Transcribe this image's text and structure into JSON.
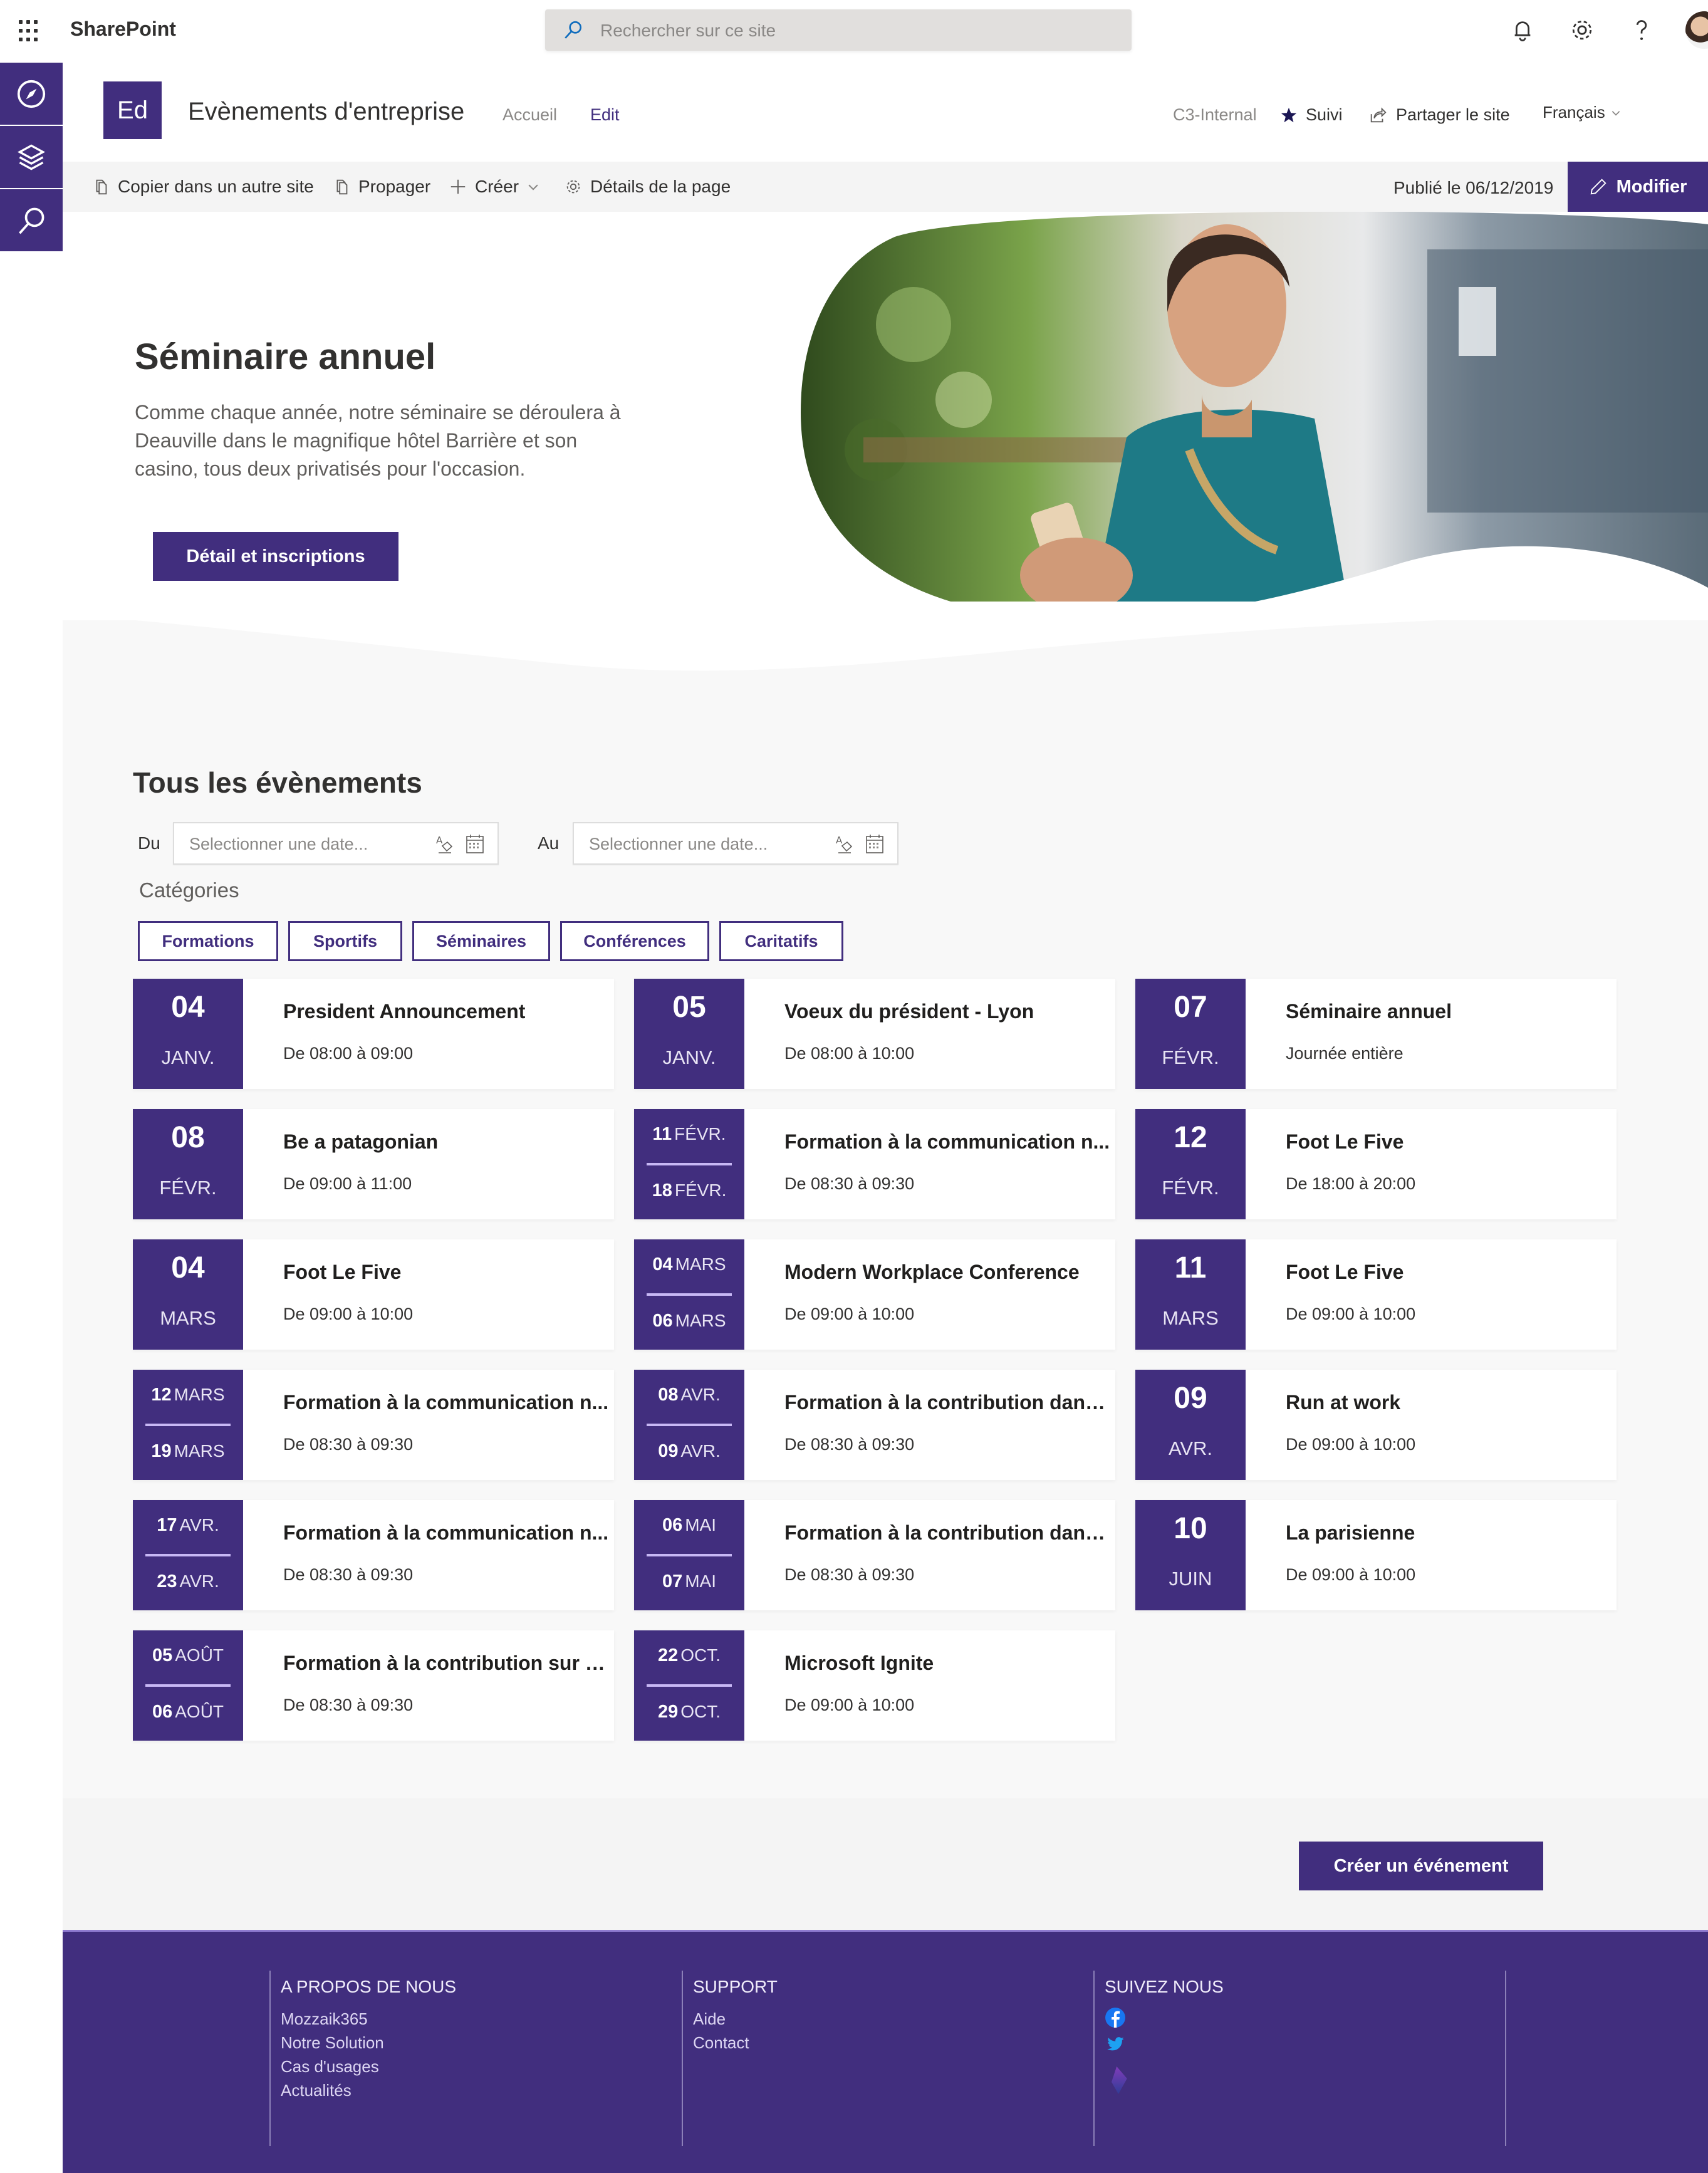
{
  "suitebar": {
    "app_name": "SharePoint",
    "search_placeholder": "Rechercher sur ce site",
    "icons": [
      "waffle-icon",
      "bell-icon",
      "gear-icon",
      "help-icon",
      "avatar"
    ]
  },
  "rail": {
    "items": [
      {
        "icon": "compass-icon",
        "label": "Explorer"
      },
      {
        "icon": "layers-icon",
        "label": "Sites"
      },
      {
        "icon": "search-icon",
        "label": "Rechercher"
      }
    ]
  },
  "site": {
    "logo_initials": "Ed",
    "title": "Evènements d'entreprise",
    "nav": [
      {
        "label": "Accueil"
      },
      {
        "label": "Edit"
      }
    ],
    "classification": "C3-Internal",
    "follow_label": "Suivi",
    "share_label": "Partager le site",
    "language": "Français"
  },
  "commandbar": {
    "items": [
      {
        "label": "Copier dans un autre site",
        "icon": "copy-icon"
      },
      {
        "label": "Propager",
        "icon": "copy-icon"
      },
      {
        "label": "Créer",
        "icon": "plus-icon"
      },
      {
        "label": "Détails de la page",
        "icon": "gear-icon"
      }
    ],
    "published": "Publié le 06/12/2019",
    "modify_label": "Modifier"
  },
  "hero": {
    "title": "Séminaire annuel",
    "description": "Comme chaque année, notre séminaire se déroulera à Deauville dans le magnifique hôtel Barrière et son casino, tous deux privatisés pour l'occasion.",
    "button_label": "Détail et inscriptions"
  },
  "events": {
    "title": "Tous les évènements",
    "from_label": "Du",
    "to_label": "Au",
    "date_placeholder": "Selectionner une date...",
    "categories_label": "Catégories",
    "categories": [
      "Formations",
      "Sportifs",
      "Séminaires",
      "Conférences",
      "Caritatifs"
    ],
    "items": [
      {
        "day": "04",
        "month": "JANV.",
        "title": "President Announcement",
        "time": "De 08:00 à 09:00"
      },
      {
        "day": "05",
        "month": "JANV.",
        "title": "Voeux du président - Lyon",
        "time": "De 08:00 à 10:00"
      },
      {
        "day": "07",
        "month": "FÉVR.",
        "title": "Séminaire annuel",
        "time": "Journée entière"
      },
      {
        "day": "08",
        "month": "FÉVR.",
        "title": "Be a patagonian",
        "time": "De 09:00 à 11:00"
      },
      {
        "start_day": "11",
        "start_month": "FÉVR.",
        "end_day": "18",
        "end_month": "FÉVR.",
        "title": "Formation à la communication n...",
        "time": "De 08:30 à 09:30"
      },
      {
        "day": "12",
        "month": "FÉVR.",
        "title": "Foot Le Five",
        "time": "De 18:00 à 20:00"
      },
      {
        "day": "04",
        "month": "MARS",
        "title": "Foot Le Five",
        "time": "De 09:00 à 10:00"
      },
      {
        "start_day": "04",
        "start_month": "MARS",
        "end_day": "06",
        "end_month": "MARS",
        "title": "Modern Workplace Conference",
        "time": "De 09:00 à 10:00"
      },
      {
        "day": "11",
        "month": "MARS",
        "title": "Foot Le Five",
        "time": "De 09:00 à 10:00"
      },
      {
        "start_day": "12",
        "start_month": "MARS",
        "end_day": "19",
        "end_month": "MARS",
        "title": "Formation à la communication n...",
        "time": "De 08:30 à 09:30"
      },
      {
        "start_day": "08",
        "start_month": "AVR.",
        "end_day": "09",
        "end_month": "AVR.",
        "title": "Formation à la contribution dans...",
        "time": "De 08:30 à 09:30"
      },
      {
        "day": "09",
        "month": "AVR.",
        "title": "Run at work",
        "time": "De 09:00 à 10:00"
      },
      {
        "start_day": "17",
        "start_month": "AVR.",
        "end_day": "23",
        "end_month": "AVR.",
        "title": "Formation à la communication n...",
        "time": "De 08:30 à 09:30"
      },
      {
        "start_day": "06",
        "start_month": "MAI",
        "end_day": "07",
        "end_month": "MAI",
        "title": "Formation à la contribution dans...",
        "time": "De 08:30 à 09:30"
      },
      {
        "day": "10",
        "month": "JUIN",
        "title": "La parisienne",
        "time": "De 09:00 à 10:00"
      },
      {
        "start_day": "05",
        "start_month": "AOÛT",
        "end_day": "06",
        "end_month": "AOÛT",
        "title": "Formation à la contribution sur n...",
        "time": "De 08:30 à 09:30"
      },
      {
        "start_day": "22",
        "start_month": "OCT.",
        "end_day": "29",
        "end_month": "OCT.",
        "title": "Microsoft Ignite",
        "time": "De 09:00 à 10:00"
      }
    ],
    "create_label": "Créer un événement"
  },
  "footer": {
    "columns": [
      {
        "heading": "A PROPOS DE NOUS",
        "links": [
          "Mozzaik365",
          "Notre Solution",
          "Cas d'usages",
          "Actualités"
        ]
      },
      {
        "heading": "SUPPORT",
        "links": [
          "Aide",
          "Contact"
        ]
      },
      {
        "heading": "SUIVEZ NOUS",
        "social": [
          "facebook-icon",
          "twitter-icon",
          "mozzaik-icon"
        ]
      }
    ]
  },
  "colors": {
    "brand": "#412e7e",
    "accent_light": "#c7b8f5",
    "text": "#323130",
    "command_bar_bg": "#f4f4f4",
    "section_bg": "#f8f8f8"
  }
}
